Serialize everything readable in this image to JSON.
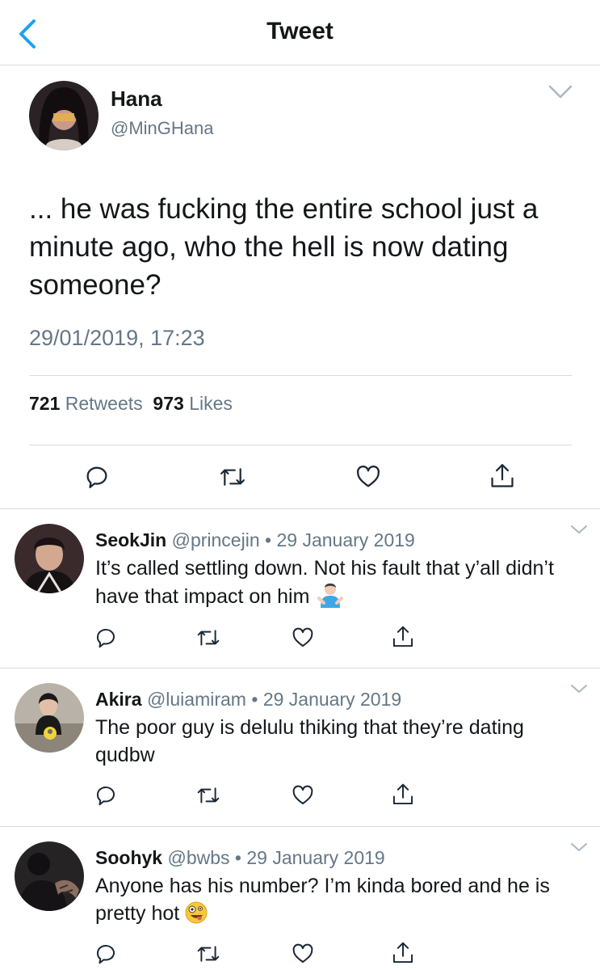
{
  "header": {
    "title": "Tweet"
  },
  "tweet": {
    "name": "Hana",
    "handle": "@MinGHana",
    "text": "... he was fucking the entire school just a minute ago, who the hell is now dating someone?",
    "timestamp": "29/01/2019, 17:23",
    "retweets_count": "721",
    "retweets_label": "Retweets",
    "likes_count": "973",
    "likes_label": "Likes"
  },
  "replies": [
    {
      "name": "SeokJin",
      "handle": "@princejin",
      "date": "29 January 2019",
      "text": "It’s called settling down. Not his fault that y’all didn’t have that impact on him",
      "emoji": "person-shrugging"
    },
    {
      "name": "Akira",
      "handle": "@luiamiram",
      "date": "29 January 2019",
      "text": "The poor guy is delulu thiking that they’re dating qudbw",
      "emoji": ""
    },
    {
      "name": "Soohyk",
      "handle": "@bwbs",
      "date": "29 January 2019",
      "text": "Anyone has his number? I’m kinda bored and he is pretty hot",
      "emoji": "zany-face"
    }
  ],
  "separator": "•",
  "colors": {
    "accent": "#1da1f2",
    "text": "#14171a",
    "muted": "#657786",
    "icon": "#1b2836",
    "divider": "#d8dcdf"
  },
  "icons": [
    "back-chevron-icon",
    "chevron-down-icon",
    "reply-icon",
    "retweet-icon",
    "like-icon",
    "share-icon"
  ]
}
